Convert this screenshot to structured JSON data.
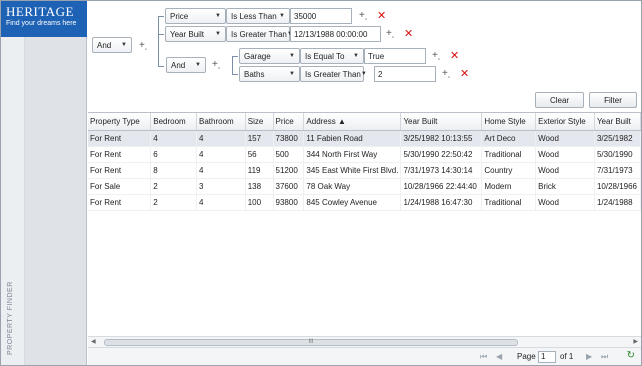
{
  "brand": {
    "name": "HERITAGE",
    "tagline": "Find your dreams here"
  },
  "sidebar": {
    "vertical_label": "PROPERTY FINDER"
  },
  "filter": {
    "root_operator": "And",
    "group_operator": "And",
    "conditions": [
      {
        "field": "Price",
        "operator": "Is Less Than",
        "value": "35000"
      },
      {
        "field": "Year Built",
        "operator": "Is Greater Than",
        "value": "12/13/1988 00:00:00"
      },
      {
        "field": "Garage",
        "operator": "Is Equal To",
        "value": "True"
      },
      {
        "field": "Baths",
        "operator": "Is Greater Than",
        "value": "2"
      }
    ],
    "clear_label": "Clear",
    "filter_label": "Filter"
  },
  "grid": {
    "columns": [
      "Property Type",
      "Bedroom",
      "Bathroom",
      "Size",
      "Price",
      "Address ▲",
      "Year Built",
      "Home Style",
      "Exterior Style",
      "Year Built"
    ],
    "rows": [
      [
        "For Rent",
        "4",
        "4",
        "157",
        "73800",
        "11 Fabien Road",
        "3/25/1982 10:13:55",
        "Art Deco",
        "Wood",
        "3/25/1982"
      ],
      [
        "For Rent",
        "6",
        "4",
        "56",
        "500",
        "344 North First Way",
        "5/30/1990 22:50:42",
        "Traditional",
        "Wood",
        "5/30/1990"
      ],
      [
        "For Rent",
        "8",
        "4",
        "119",
        "51200",
        "345 East White First Blvd.",
        "7/31/1973 14:30:14",
        "Country",
        "Wood",
        "7/31/1973"
      ],
      [
        "For Sale",
        "2",
        "3",
        "138",
        "37600",
        "78 Oak Way",
        "10/28/1966 22:44:40",
        "Modern",
        "Brick",
        "10/28/1966"
      ],
      [
        "For Rent",
        "2",
        "4",
        "100",
        "93800",
        "845 Cowley Avenue",
        "1/24/1988 16:47:30",
        "Traditional",
        "Wood",
        "1/24/1988"
      ]
    ]
  },
  "scrollbar": {
    "left": "◀",
    "right": "▶",
    "grip": "III"
  },
  "pager": {
    "first": "⏮",
    "prev": "◀",
    "page_label": "Page",
    "page_value": "1",
    "of_label": "of 1",
    "next": "▶",
    "last": "⏭",
    "refresh": "↻"
  },
  "colors": {
    "brand_blue": "#1e62b5",
    "delete_red": "#dd1111"
  }
}
